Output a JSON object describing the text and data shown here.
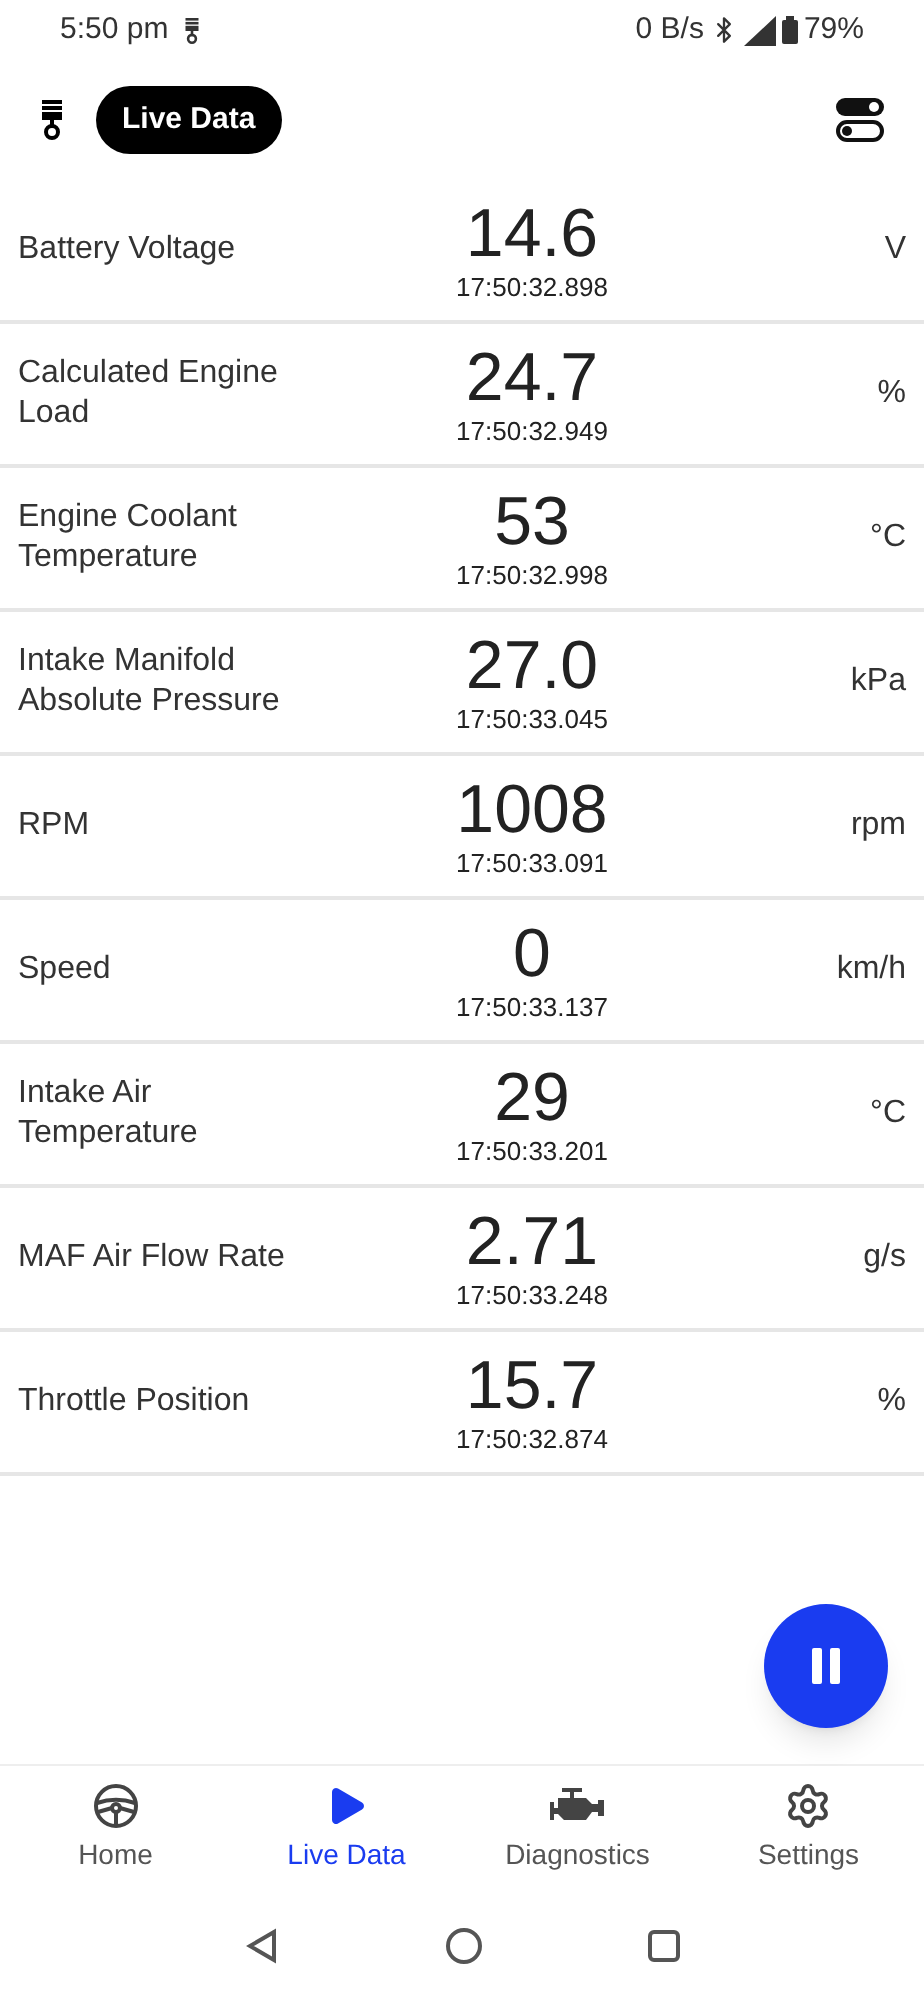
{
  "status_bar": {
    "time": "5:50 pm",
    "net_speed": "0 B/s",
    "battery": "79%"
  },
  "header": {
    "title": "Live Data"
  },
  "readings": [
    {
      "name": "Battery Voltage",
      "value": "14.6",
      "time": "17:50:32.898",
      "unit": "V"
    },
    {
      "name": "Calculated Engine Load",
      "value": "24.7",
      "time": "17:50:32.949",
      "unit": "%"
    },
    {
      "name": "Engine Coolant Temperature",
      "value": "53",
      "time": "17:50:32.998",
      "unit": "°C"
    },
    {
      "name": "Intake Manifold Absolute Pressure",
      "value": "27.0",
      "time": "17:50:33.045",
      "unit": "kPa"
    },
    {
      "name": "RPM",
      "value": "1008",
      "time": "17:50:33.091",
      "unit": "rpm"
    },
    {
      "name": "Speed",
      "value": "0",
      "time": "17:50:33.137",
      "unit": "km/h"
    },
    {
      "name": "Intake Air Temperature",
      "value": "29",
      "time": "17:50:33.201",
      "unit": "°C"
    },
    {
      "name": "MAF Air Flow Rate",
      "value": "2.71",
      "time": "17:50:33.248",
      "unit": "g/s"
    },
    {
      "name": "Throttle Position",
      "value": "15.7",
      "time": "17:50:32.874",
      "unit": "%"
    }
  ],
  "bottom_nav": [
    {
      "kind": "home",
      "label": "Home",
      "selected": false
    },
    {
      "kind": "live",
      "label": "Live Data",
      "selected": true
    },
    {
      "kind": "diagnostics",
      "label": "Diagnostics",
      "selected": false
    },
    {
      "kind": "settings",
      "label": "Settings",
      "selected": false
    }
  ]
}
